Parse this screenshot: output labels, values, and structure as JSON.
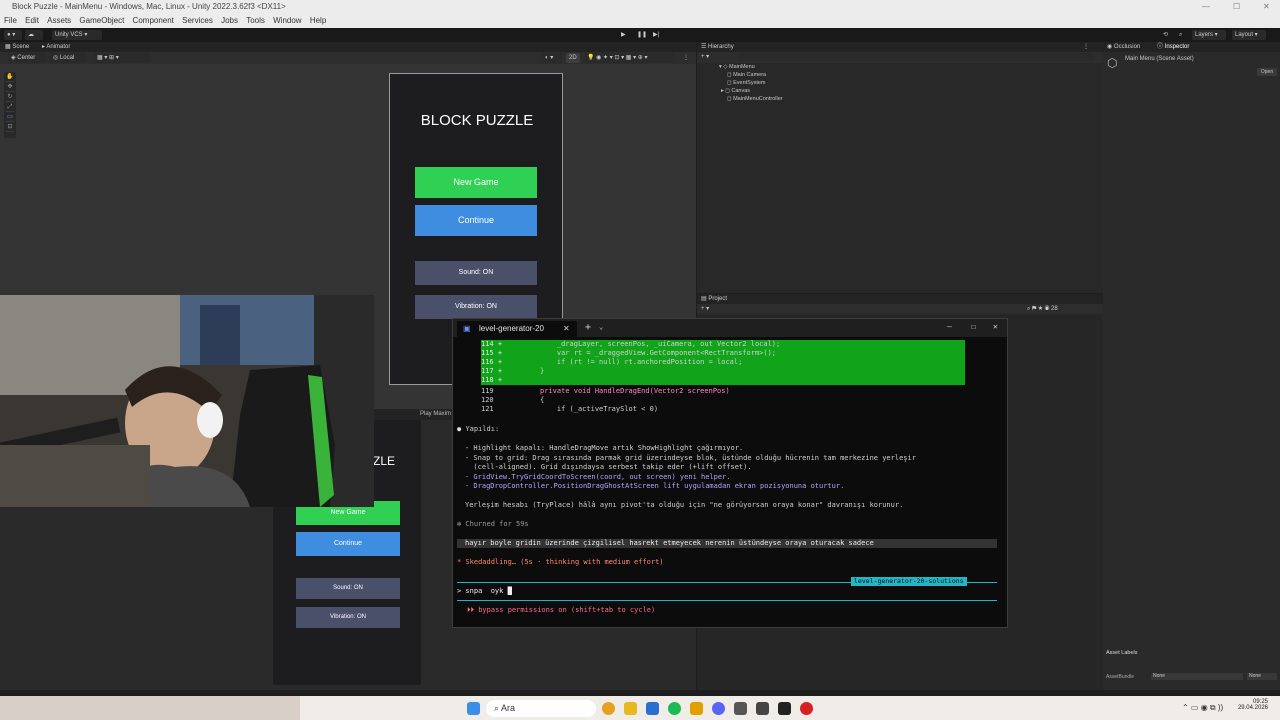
{
  "window": {
    "title": "Block Puzzle - MainMenu - Windows, Mac, Linux - Unity 2022.3.62f3 <DX11>"
  },
  "menubar": [
    "File",
    "Edit",
    "Assets",
    "GameObject",
    "Component",
    "Services",
    "Jobs",
    "Tools",
    "Window",
    "Help"
  ],
  "toolbar": {
    "vcs": "Unity VCS",
    "layers": "Layers",
    "layout": "Layout"
  },
  "scene": {
    "tabs": [
      "Scene",
      "Animator"
    ],
    "pivot": "Center",
    "space": "Local",
    "zoom": "2D"
  },
  "game": {
    "tab": "Play Maxim",
    "title_partial": "ZLE"
  },
  "ui": {
    "title": "BLOCK PUZZLE",
    "new_game": "New Game",
    "continue": "Continue",
    "sound": "Sound: ON",
    "vibration": "Vibration: ON"
  },
  "colors": {
    "green": "#2fd054",
    "blue": "#3f8de0",
    "slate": "#4a4f6a",
    "diff": "#11a31a",
    "accent": "#22b7c8"
  },
  "hierarchy": {
    "tab": "Hierarchy",
    "root": "MainMenu",
    "children": [
      "Main Camera",
      "EventSystem",
      "Canvas",
      "MainMenuController"
    ]
  },
  "project": {
    "tab": "Project",
    "count": "28"
  },
  "inspector": {
    "tabs": [
      "Occlusion",
      "Inspector"
    ],
    "asset": "Main Menu (Scene Asset)",
    "open": "Open",
    "asset_labels": "Asset Labels",
    "bundle_label": "AssetBundle",
    "bundle_value": "None",
    "variant": "None"
  },
  "terminal": {
    "tab": "level-generator-20",
    "diff_lines": [
      {
        "n": "114 +",
        "code": "            _dragLayer, screenPos, _uiCamera, out Vector2 local);"
      },
      {
        "n": "115 +",
        "code": "            var rt = _draggedView.GetComponent<RectTransform>();"
      },
      {
        "n": "116 +",
        "code": "            if (rt != null) rt.anchoredPosition = local;"
      },
      {
        "n": "117 +",
        "code": "        }"
      },
      {
        "n": "118 +",
        "code": ""
      }
    ],
    "code_lines": [
      {
        "n": "119",
        "code": "        private void HandleDragEnd(Vector2 screenPos)"
      },
      {
        "n": "120",
        "code": "        {"
      },
      {
        "n": "121",
        "code": "            if (_activeTraySlot < 0)"
      }
    ],
    "done": "Yapıldı:",
    "bullets": [
      "- Highlight kapalı: HandleDragMove artık ShowHighlight çağırmıyor.",
      "- Snap to grid: Drag sırasında parmak grid üzerindeyse blok, üstünde olduğu hücrenin tam merkezine yerleşir",
      "  (cell-aligned). Grid dışındaysa serbest takip eder (+lift offset).",
      "- GridView.TryGridCoordToScreen(coord, out screen) yeni helper.",
      "- DragDropController.PositionDragGhostAtScreen lift uygulamadan ekran pozisyonuna oturtur."
    ],
    "note": "Yerleşim hesabı (TryPlace) hâlâ aynı pivot'ta olduğu için \"ne görüyorsan oraya konar\" davranışı korunur.",
    "churned": "✻ Churned for 59s",
    "user_msg": "hayır boyle gridin üzerinde çizgilisel hasrekt etmeyecek nerenin üstündeyse oraya oturacak sadece",
    "status": "* Skedaddling… (5s · thinking with medium effort)",
    "branch": "level-generator-20-solutions",
    "prompt": "> snpa  oyk ",
    "bypass": "⏵⏵ bypass permissions on (shift+tab to cycle)"
  },
  "taskbar": {
    "search": "Ara",
    "time": "09:25",
    "date": "29.04.2026"
  }
}
